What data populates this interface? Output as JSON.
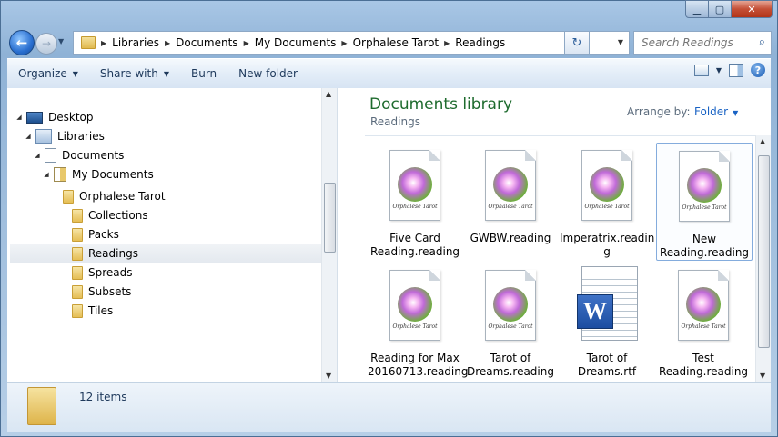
{
  "window": {
    "min_glyph": "▁",
    "max_glyph": "▢",
    "close_glyph": "✕"
  },
  "nav": {
    "back_glyph": "←",
    "forward_glyph": "→"
  },
  "address": {
    "crumbs": [
      "Libraries",
      "Documents",
      "My Documents",
      "Orphalese Tarot",
      "Readings"
    ],
    "refresh_glyph": "↻"
  },
  "search": {
    "placeholder": "Search Readings"
  },
  "toolbar": {
    "organize": "Organize",
    "share_with": "Share with",
    "burn": "Burn",
    "new_folder": "New folder",
    "help": "?"
  },
  "tree": [
    {
      "label": "Desktop"
    },
    {
      "label": "Libraries"
    },
    {
      "label": "Documents"
    },
    {
      "label": "My Documents"
    },
    {
      "label": "Orphalese Tarot"
    },
    {
      "label": "Collections"
    },
    {
      "label": "Packs"
    },
    {
      "label": "Readings"
    },
    {
      "label": "Spreads"
    },
    {
      "label": "Subsets"
    },
    {
      "label": "Tiles"
    }
  ],
  "content": {
    "title": "Documents library",
    "subtitle": "Readings",
    "arrange_label": "Arrange by:",
    "arrange_value": "Folder",
    "orb_text": "Orphalese Tarot",
    "files": [
      {
        "line1": "Five Card",
        "line2": "Reading.reading",
        "kind": "reading"
      },
      {
        "line1": "GWBW.reading",
        "line2": "",
        "kind": "reading"
      },
      {
        "line1": "Imperatrix.readin",
        "line2": "g",
        "kind": "reading"
      },
      {
        "line1": "New",
        "line2": "Reading.reading",
        "kind": "reading"
      },
      {
        "line1": "Reading for Max",
        "line2": "20160713.reading",
        "kind": "reading"
      },
      {
        "line1": "Tarot of",
        "line2": "Dreams.reading",
        "kind": "reading"
      },
      {
        "line1": "Tarot of",
        "line2": "Dreams.rtf",
        "kind": "word"
      },
      {
        "line1": "Test",
        "line2": "Reading.reading",
        "kind": "reading"
      }
    ],
    "word_letter": "W"
  },
  "status": {
    "count": "12 items"
  }
}
